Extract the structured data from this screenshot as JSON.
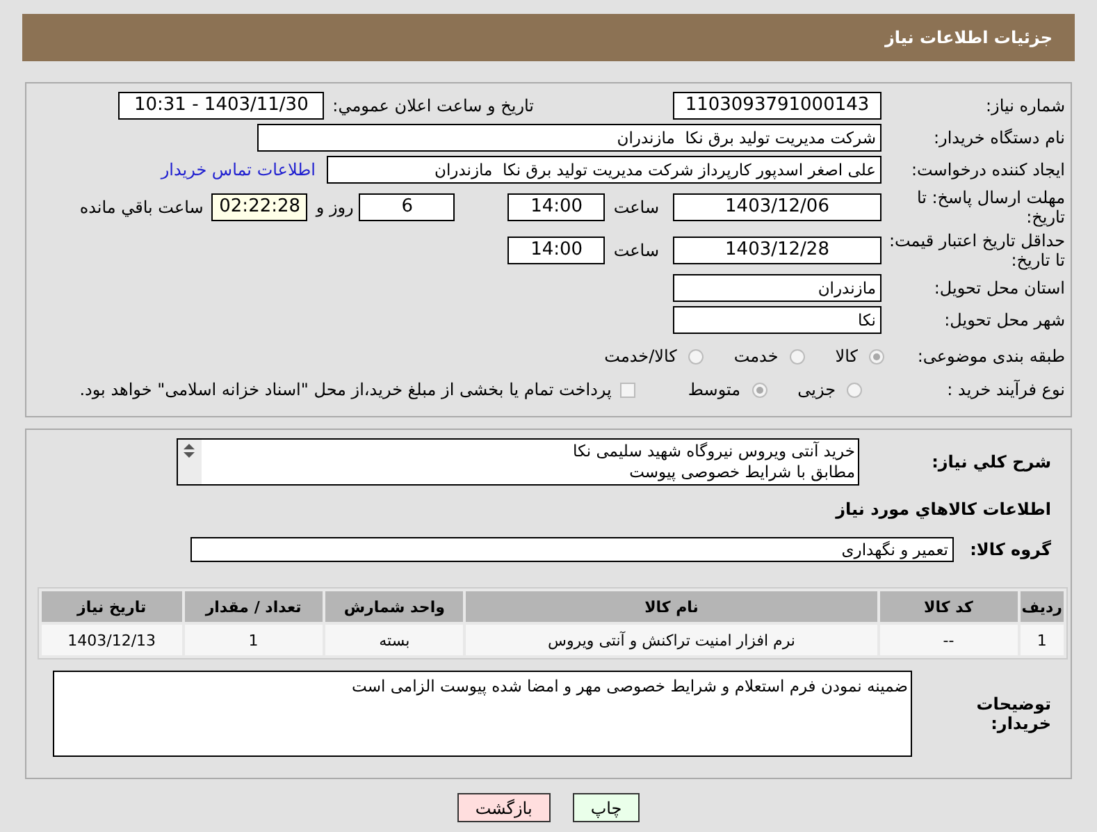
{
  "header": {
    "title": "جزئیات اطلاعات نیاز"
  },
  "details": {
    "need_number": {
      "label": "شماره نیاز:",
      "value": "1103093791000143"
    },
    "announce": {
      "label": "تاریخ و ساعت اعلان عمومي:",
      "value": "1403/11/30 - 10:31"
    },
    "buyer": {
      "label": "نام دستگاه خریدار:",
      "value": "شرکت مدیریت تولید برق نکا  مازندران"
    },
    "creator": {
      "label": "ایجاد کننده درخواست:",
      "value": "علی اصغر اسدپور کارپرداز شرکت مدیریت تولید برق نکا  مازندران",
      "link": "اطلاعات تماس خریدار"
    },
    "deadline": {
      "label": "مهلت ارسال پاسخ: تا تاریخ:",
      "date": "1403/12/06",
      "time_label": "ساعت",
      "time": "14:00",
      "days": "6",
      "days_label": "روز و",
      "remaining": "02:22:28",
      "remaining_label": "ساعت باقي مانده"
    },
    "validity": {
      "label": "حداقل تاریخ اعتبار قیمت: تا تاریخ:",
      "date": "1403/12/28",
      "time_label": "ساعت",
      "time": "14:00"
    },
    "province": {
      "label": "استان محل تحویل:",
      "value": "مازندران"
    },
    "city": {
      "label": "شهر محل تحویل:",
      "value": "نکا"
    },
    "category": {
      "label": "طبقه بندی موضوعی:",
      "options": [
        {
          "label": "کالا",
          "selected": true
        },
        {
          "label": "خدمت",
          "selected": false
        },
        {
          "label": "کالا/خدمت",
          "selected": false
        }
      ]
    },
    "process": {
      "label": "نوع فرآیند خرید :",
      "options": [
        {
          "label": "جزیی",
          "selected": false
        },
        {
          "label": "متوسط",
          "selected": true
        }
      ],
      "treasury": {
        "label": "پرداخت تمام یا بخشی از مبلغ خرید،از محل \"اسناد خزانه اسلامی\" خواهد بود.",
        "checked": false
      }
    }
  },
  "needs": {
    "description": {
      "label": "شرح کلي نیاز:",
      "value": "خرید آنتی ویروس نیروگاه شهید سلیمی نکا\nمطابق با شرایط خصوصی پیوست"
    },
    "section_title": "اطلاعات کالاهاي مورد نیاز",
    "group": {
      "label": "گروه کالا:",
      "value": "تعمیر و نگهداری"
    },
    "table": {
      "columns": [
        "ردیف",
        "کد کالا",
        "نام کالا",
        "واحد شمارش",
        "تعداد / مقدار",
        "تاریخ نیاز"
      ],
      "rows": [
        [
          "1",
          "--",
          "نرم افزار امنیت تراکنش و آنتی ویروس",
          "بسته",
          "1",
          "1403/12/13"
        ]
      ]
    },
    "buyer_notes": {
      "label": "توضیحات خریدار:",
      "value": "ضمینه نمودن فرم استعلام و شرایط خصوصی مهر و امضا شده پیوست الزامی است"
    }
  },
  "buttons": [
    {
      "label": "چاپ",
      "kind": "print"
    },
    {
      "label": "بازگشت",
      "kind": "back"
    }
  ]
}
